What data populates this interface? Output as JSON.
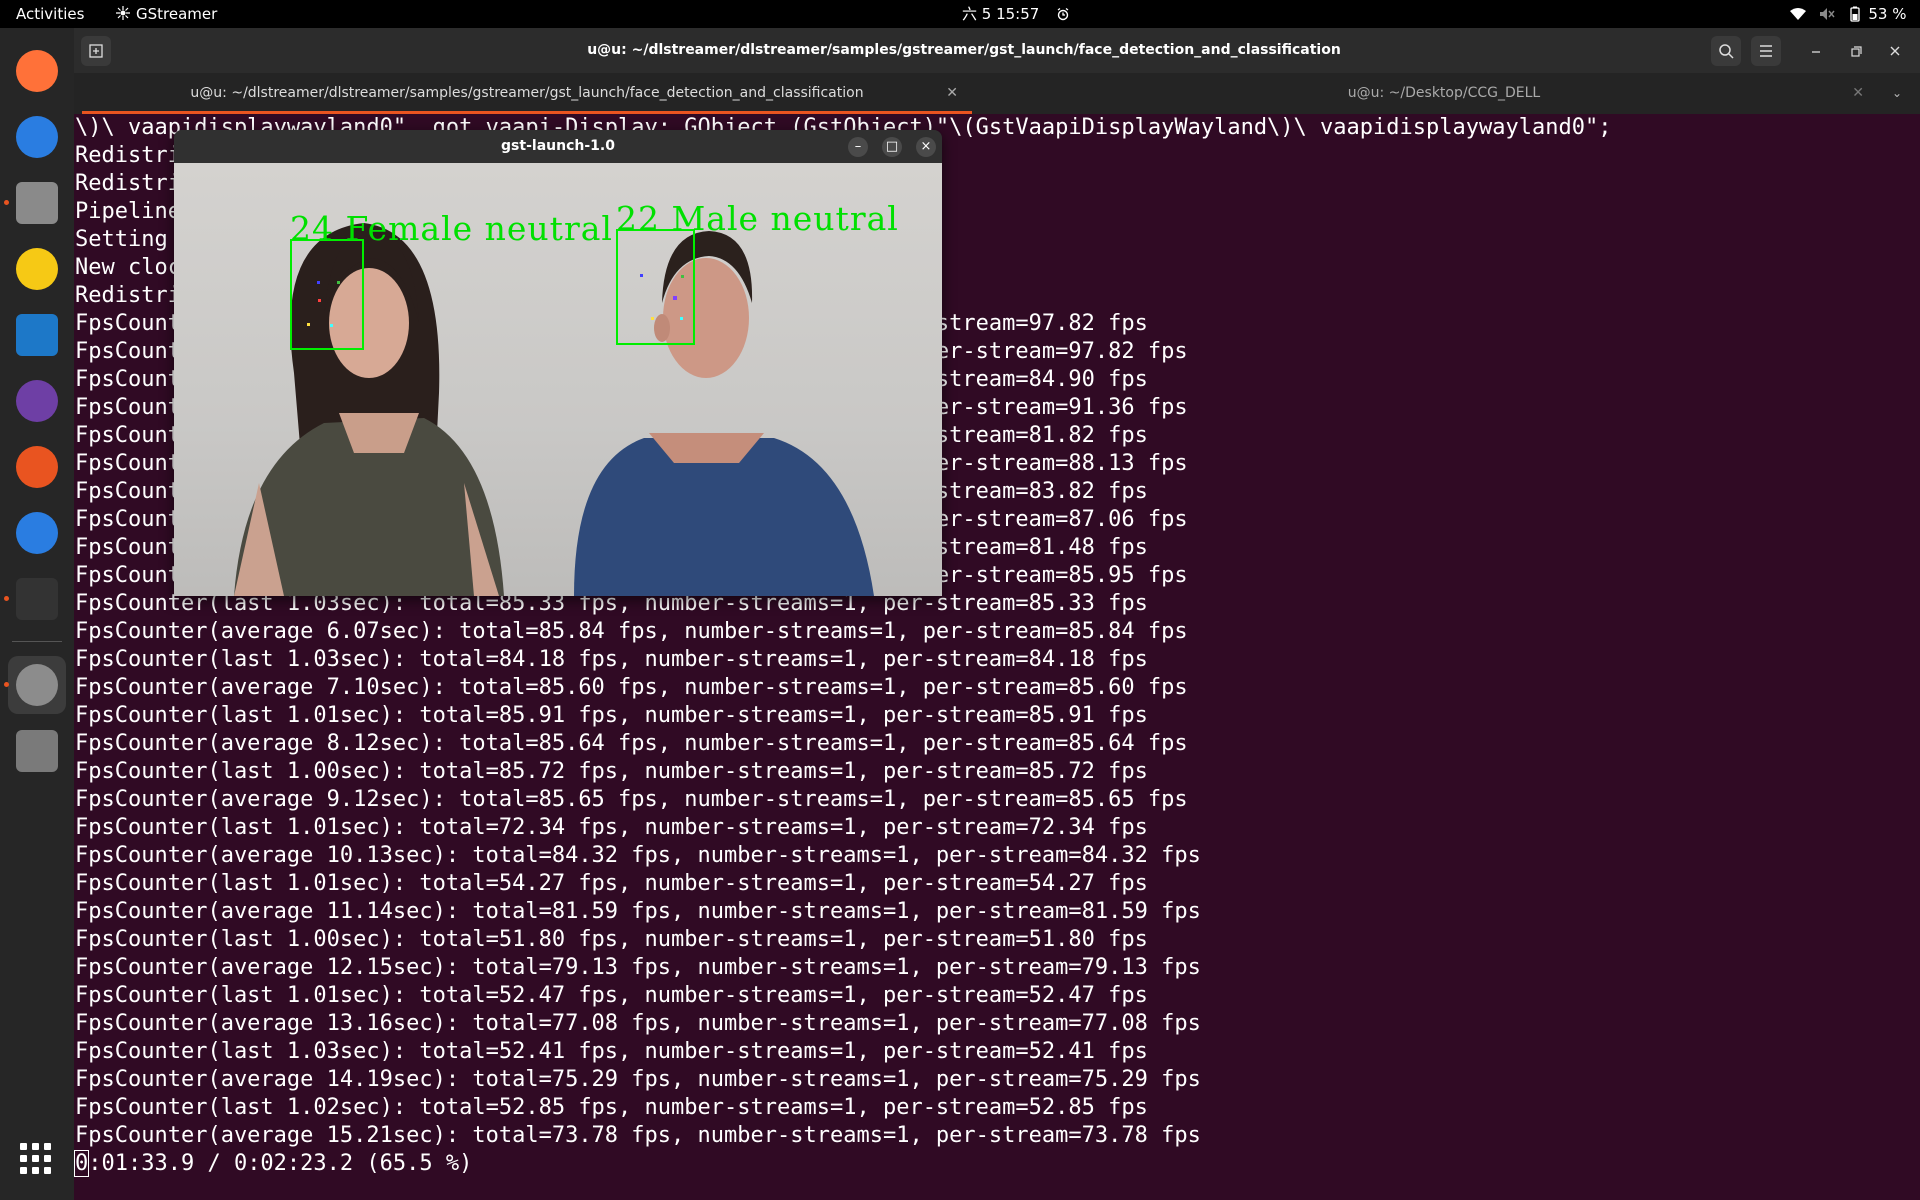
{
  "topbar": {
    "activities": "Activities",
    "app_name": "GStreamer",
    "clock": "六 5  15:57",
    "battery": "53 %"
  },
  "dock": {
    "items": [
      {
        "name": "firefox",
        "color": "#ff7139"
      },
      {
        "name": "thunderbird",
        "color": "#2a7de1"
      },
      {
        "name": "files",
        "color": "#8a8a8a"
      },
      {
        "name": "rhythmbox",
        "color": "#f6c915"
      },
      {
        "name": "libreoffice-writer",
        "color": "#1d78c8"
      },
      {
        "name": "cheese",
        "color": "#6e3fa5"
      },
      {
        "name": "software",
        "color": "#e95420"
      },
      {
        "name": "help",
        "color": "#2a7de1"
      },
      {
        "name": "terminal",
        "color": "#333333"
      },
      {
        "name": "settings",
        "color": "#8c8c8c"
      },
      {
        "name": "trash",
        "color": "#7a7a7a"
      }
    ]
  },
  "terminal": {
    "title": "u@u: ~/dlstreamer/dlstreamer/samples/gstreamer/gst_launch/face_detection_and_classification",
    "tabs": [
      {
        "label": "u@u: ~/dlstreamer/dlstreamer/samples/gstreamer/gst_launch/face_detection_and_classification"
      },
      {
        "label": "u@u: ~/Desktop/CCG_DELL"
      }
    ],
    "lines": [
      "\\)\\ vaapidisplaywayland0\", got vaapi-Display: GObject (GstObject)\"\\(GstVaapiDisplayWayland\\)\\ vaapidisplaywayland0\";",
      "Redistribute latency...",
      "Redistribute latency...",
      "Pipeline is PREROLLED ...",
      "Setting pipeline to PLAYING ...",
      "New clock: GstSystemClock",
      "Redistribute latency...",
      "FpsCounter(last 1.01sec): total=97.82 fps, number-streams=1, per-stream=97.82 fps",
      "FpsCounter(average 1.01sec): total=97.82 fps, number-streams=1, per-stream=97.82 fps",
      "FpsCounter(last 1.03sec): total=84.90 fps, number-streams=1, per-stream=84.90 fps",
      "FpsCounter(average 2.04sec): total=91.36 fps, number-streams=1, per-stream=91.36 fps",
      "FpsCounter(last 1.01sec): total=81.82 fps, number-streams=1, per-stream=81.82 fps",
      "FpsCounter(average 3.05sec): total=88.13 fps, number-streams=1, per-stream=88.13 fps",
      "FpsCounter(last 1.01sec): total=83.82 fps, number-streams=1, per-stream=83.82 fps",
      "FpsCounter(average 4.06sec): total=87.06 fps, number-streams=1, per-stream=87.06 fps",
      "FpsCounter(last 1.01sec): total=81.48 fps, number-streams=1, per-stream=81.48 fps",
      "FpsCounter(average 5.07sec): total=85.95 fps, number-streams=1, per-stream=85.95 fps",
      "FpsCounter(last 1.03sec): total=85.33 fps, number-streams=1, per-stream=85.33 fps",
      "FpsCounter(average 6.07sec): total=85.84 fps, number-streams=1, per-stream=85.84 fps",
      "FpsCounter(last 1.03sec): total=84.18 fps, number-streams=1, per-stream=84.18 fps",
      "FpsCounter(average 7.10sec): total=85.60 fps, number-streams=1, per-stream=85.60 fps",
      "FpsCounter(last 1.01sec): total=85.91 fps, number-streams=1, per-stream=85.91 fps",
      "FpsCounter(average 8.12sec): total=85.64 fps, number-streams=1, per-stream=85.64 fps",
      "FpsCounter(last 1.00sec): total=85.72 fps, number-streams=1, per-stream=85.72 fps",
      "FpsCounter(average 9.12sec): total=85.65 fps, number-streams=1, per-stream=85.65 fps",
      "FpsCounter(last 1.01sec): total=72.34 fps, number-streams=1, per-stream=72.34 fps",
      "FpsCounter(average 10.13sec): total=84.32 fps, number-streams=1, per-stream=84.32 fps",
      "FpsCounter(last 1.01sec): total=54.27 fps, number-streams=1, per-stream=54.27 fps",
      "FpsCounter(average 11.14sec): total=81.59 fps, number-streams=1, per-stream=81.59 fps",
      "FpsCounter(last 1.00sec): total=51.80 fps, number-streams=1, per-stream=51.80 fps",
      "FpsCounter(average 12.15sec): total=79.13 fps, number-streams=1, per-stream=79.13 fps",
      "FpsCounter(last 1.01sec): total=52.47 fps, number-streams=1, per-stream=52.47 fps",
      "FpsCounter(average 13.16sec): total=77.08 fps, number-streams=1, per-stream=77.08 fps",
      "FpsCounter(last 1.03sec): total=52.41 fps, number-streams=1, per-stream=52.41 fps",
      "FpsCounter(average 14.19sec): total=75.29 fps, number-streams=1, per-stream=75.29 fps",
      "FpsCounter(last 1.02sec): total=52.85 fps, number-streams=1, per-stream=52.85 fps",
      "FpsCounter(average 15.21sec): total=73.78 fps, number-streams=1, per-stream=73.78 fps",
      "0:01:33.9 / 0:02:23.2 (65.5 %)"
    ]
  },
  "video_window": {
    "title": "gst-launch-1.0",
    "faces": [
      {
        "label": "24 Female neutral"
      },
      {
        "label": "22 Male neutral"
      }
    ]
  },
  "colors": {
    "terminal_bg": "#300a24",
    "accent": "#e95420",
    "bbox": "#00ee00"
  }
}
